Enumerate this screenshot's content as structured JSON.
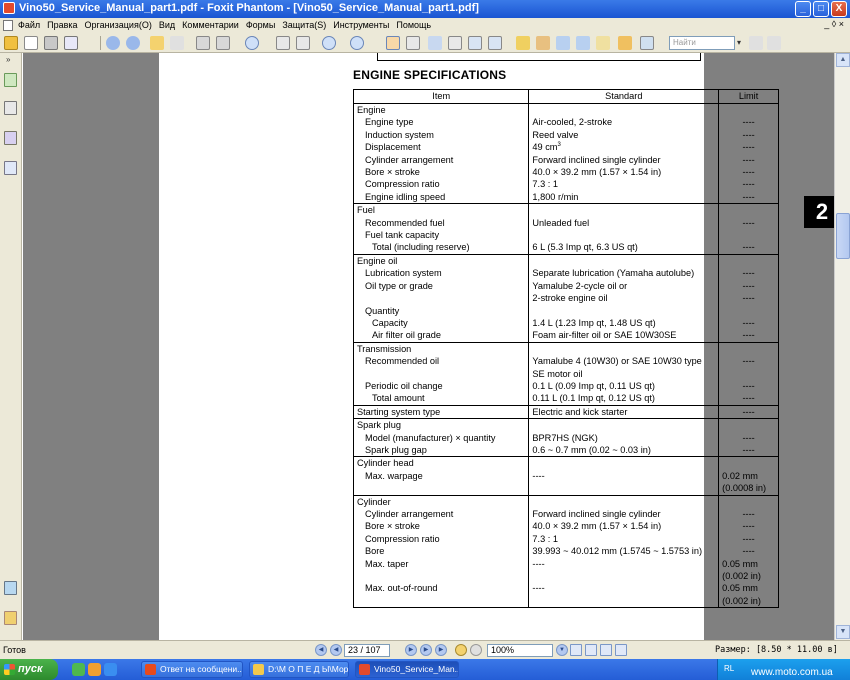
{
  "window": {
    "title": "Vino50_Service_Manual_part1.pdf - Foxit Phantom - [Vino50_Service_Manual_part1.pdf]",
    "minimize": "_",
    "maximize": "□",
    "close": "X"
  },
  "menu": {
    "items": [
      "Файл",
      "Правка",
      "Организация(O)",
      "Вид",
      "Комментарии",
      "Формы",
      "Защита(S)",
      "Инструменты",
      "Помощь"
    ],
    "mdi_controls": "_ ◊ ×"
  },
  "toolbar": {
    "search_placeholder": "Найти"
  },
  "document": {
    "header_text": "ENGINE SPECIFICATIONS",
    "title": "ENGINE SPECIFICATIONS",
    "chapter_tab": "2",
    "columns": [
      "Item",
      "Standard",
      "Limit"
    ],
    "rows": [
      {
        "item": "Engine",
        "std": "",
        "lim": "",
        "style": "grp",
        "start": true
      },
      {
        "item": "Engine type",
        "std": "Air-cooled, 2-stroke",
        "lim": "----",
        "style": "ind1"
      },
      {
        "item": "Induction system",
        "std": "Reed valve",
        "lim": "----",
        "style": "ind1"
      },
      {
        "item": "Displacement",
        "std": "49 cm",
        "sup": "3",
        "lim": "----",
        "style": "ind1"
      },
      {
        "item": "Cylinder arrangement",
        "std": "Forward inclined single cylinder",
        "lim": "----",
        "style": "ind1"
      },
      {
        "item": "Bore × stroke",
        "std": "40.0 × 39.2 mm (1.57 × 1.54 in)",
        "lim": "----",
        "style": "ind1"
      },
      {
        "item": "Compression ratio",
        "std": "7.3 : 1",
        "lim": "----",
        "style": "ind1"
      },
      {
        "item": "Engine idling speed",
        "std": "1,800 r/min",
        "lim": "----",
        "style": "ind1"
      },
      {
        "item": "Fuel",
        "std": "",
        "lim": "",
        "style": "grp",
        "start": true
      },
      {
        "item": "Recommended fuel",
        "std": "Unleaded fuel",
        "lim": "----",
        "style": "ind1"
      },
      {
        "item": "Fuel tank capacity",
        "std": "",
        "lim": "",
        "style": "ind1"
      },
      {
        "item": "Total (including reserve)",
        "std": "6 L (5.3 Imp qt, 6.3 US qt)",
        "lim": "----",
        "style": "ind2"
      },
      {
        "item": "Engine oil",
        "std": "",
        "lim": "",
        "style": "grp",
        "start": true
      },
      {
        "item": "Lubrication system",
        "std": "Separate lubrication (Yamaha autolube)",
        "lim": "----",
        "style": "ind1"
      },
      {
        "item": "Oil type or grade",
        "std": "Yamalube 2-cycle oil or",
        "lim": "----",
        "style": "ind1"
      },
      {
        "item": "",
        "std": "2-stroke engine oil",
        "lim": "----",
        "style": "ind1"
      },
      {
        "item": "Quantity",
        "std": "",
        "lim": "",
        "style": "ind1"
      },
      {
        "item": "Capacity",
        "std": "1.4 L (1.23 Imp qt, 1.48 US qt)",
        "lim": "----",
        "style": "ind2"
      },
      {
        "item": "Air filter oil grade",
        "std": "Foam air-filter oil or SAE 10W30SE",
        "lim": "----",
        "style": "ind2"
      },
      {
        "item": "Transmission",
        "std": "",
        "lim": "",
        "style": "grp",
        "start": true
      },
      {
        "item": "Recommended oil",
        "std": "Yamalube 4 (10W30) or SAE 10W30 type",
        "lim": "----",
        "style": "ind1"
      },
      {
        "item": "",
        "std": "SE motor oil",
        "lim": "",
        "style": "ind1"
      },
      {
        "item": "Periodic oil change",
        "std": "0.1 L (0.09 Imp qt, 0.11 US qt)",
        "lim": "----",
        "style": "ind1"
      },
      {
        "item": "Total amount",
        "std": "0.11 L (0.1 Imp qt, 0.12 US qt)",
        "lim": "----",
        "style": "ind2"
      },
      {
        "item": "Starting system type",
        "std": "Electric and kick starter",
        "lim": "----",
        "style": "grp",
        "start": true
      },
      {
        "item": "Spark plug",
        "std": "",
        "lim": "",
        "style": "grp",
        "start": true
      },
      {
        "item": "Model (manufacturer) × quantity",
        "std": "BPR7HS (NGK)",
        "lim": "----",
        "style": "ind1"
      },
      {
        "item": "Spark plug gap",
        "std": "0.6 ~ 0.7 mm (0.02 ~ 0.03 in)",
        "lim": "----",
        "style": "ind1"
      },
      {
        "item": "Cylinder head",
        "std": "",
        "lim": "",
        "style": "grp",
        "start": true
      },
      {
        "item": "Max. warpage",
        "std": "----",
        "lim": "0.02 mm",
        "style": "ind1",
        "limleft": true
      },
      {
        "item": "",
        "std": "",
        "lim": "(0.0008 in)",
        "style": "ind1",
        "limleft": true
      },
      {
        "item": "",
        "std": "",
        "lim": "",
        "style": "ind1"
      },
      {
        "item": "Cylinder",
        "std": "",
        "lim": "",
        "style": "grp",
        "start": true
      },
      {
        "item": "Cylinder arrangement",
        "std": "Forward inclined single cylinder",
        "lim": "----",
        "style": "ind1"
      },
      {
        "item": "Bore × stroke",
        "std": "40.0 × 39.2 mm (1.57 × 1.54 in)",
        "lim": "----",
        "style": "ind1"
      },
      {
        "item": "Compression ratio",
        "std": "7.3 : 1",
        "lim": "----",
        "style": "ind1"
      },
      {
        "item": "Bore",
        "std": "39.993 ~ 40.012 mm (1.5745 ~ 1.5753 in)",
        "lim": "----",
        "style": "ind1"
      },
      {
        "item": "Max. taper",
        "std": "----",
        "lim": "0.05 mm",
        "style": "ind1",
        "limleft": true
      },
      {
        "item": "",
        "std": "",
        "lim": "(0.002 in)",
        "style": "ind1",
        "limleft": true
      },
      {
        "item": "Max. out-of-round",
        "std": "----",
        "lim": "0.05 mm",
        "style": "ind1",
        "limleft": true
      },
      {
        "item": "",
        "std": "",
        "lim": "(0.002 in)",
        "style": "ind1",
        "limleft": true,
        "last": true
      }
    ]
  },
  "status": {
    "left": "Готов",
    "page_indicator": "23 / 107",
    "zoom": "100%",
    "size": "Размер: [8.50 * 11.00 в]"
  },
  "taskbar": {
    "start_label": "пуск",
    "tasks": [
      {
        "label": "Ответ на сообщени...",
        "active": false,
        "color": "#e84a1c"
      },
      {
        "label": "D:\\М О П Е Д Ы\\Мор...",
        "active": false,
        "color": "#f2c94c"
      },
      {
        "label": "Vino50_Service_Man...",
        "active": true,
        "color": "#e34a2c"
      }
    ],
    "tray_lang": "RL",
    "watermark": "www.moto.com.ua"
  }
}
